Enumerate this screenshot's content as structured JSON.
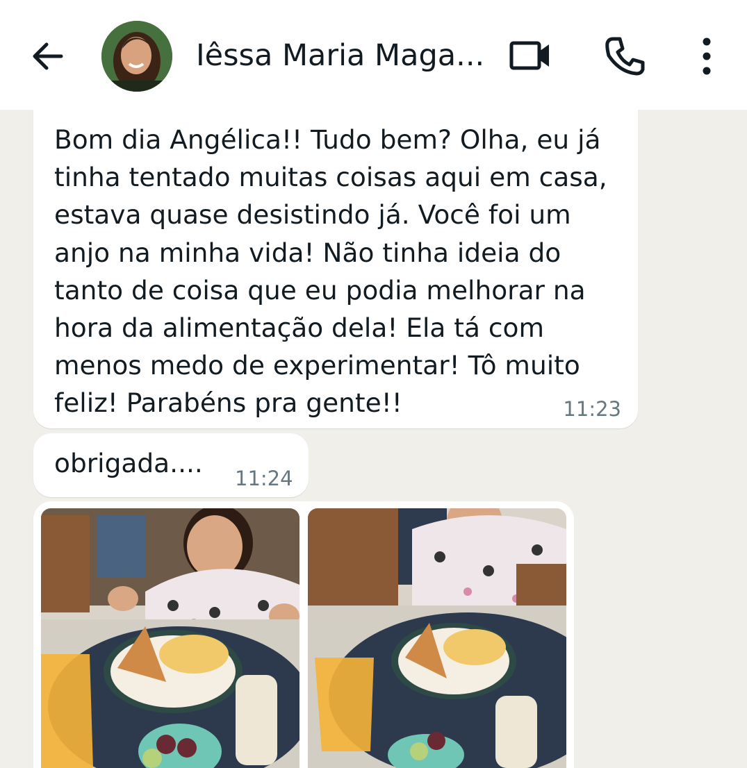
{
  "header": {
    "back_icon": "arrow-left-icon",
    "contact_name": "Iêssa Maria Maga...",
    "video_icon": "video-camera-icon",
    "call_icon": "phone-icon",
    "menu_icon": "more-vertical-icon"
  },
  "messages": [
    {
      "text": "Bom dia Angélica!! Tudo bem? Olha, eu já tinha tentado muitas coisas aqui em casa, estava quase desistindo já. Você foi um anjo na minha vida! Não tinha ideia do tanto de coisa que eu podia melhorar na hora da alimentação dela! Ela tá com menos medo de experimentar! Tô muito feliz! Parabéns pra gente!!",
      "time": "11:23"
    },
    {
      "text": "obrigada....",
      "time": "11:24"
    }
  ],
  "photos": [
    {
      "icon": "child-breakfast-photo"
    },
    {
      "icon": "child-breakfast-photo"
    }
  ],
  "colors": {
    "background": "#f1efea",
    "bubble": "#ffffff",
    "timestamp": "#667781"
  }
}
